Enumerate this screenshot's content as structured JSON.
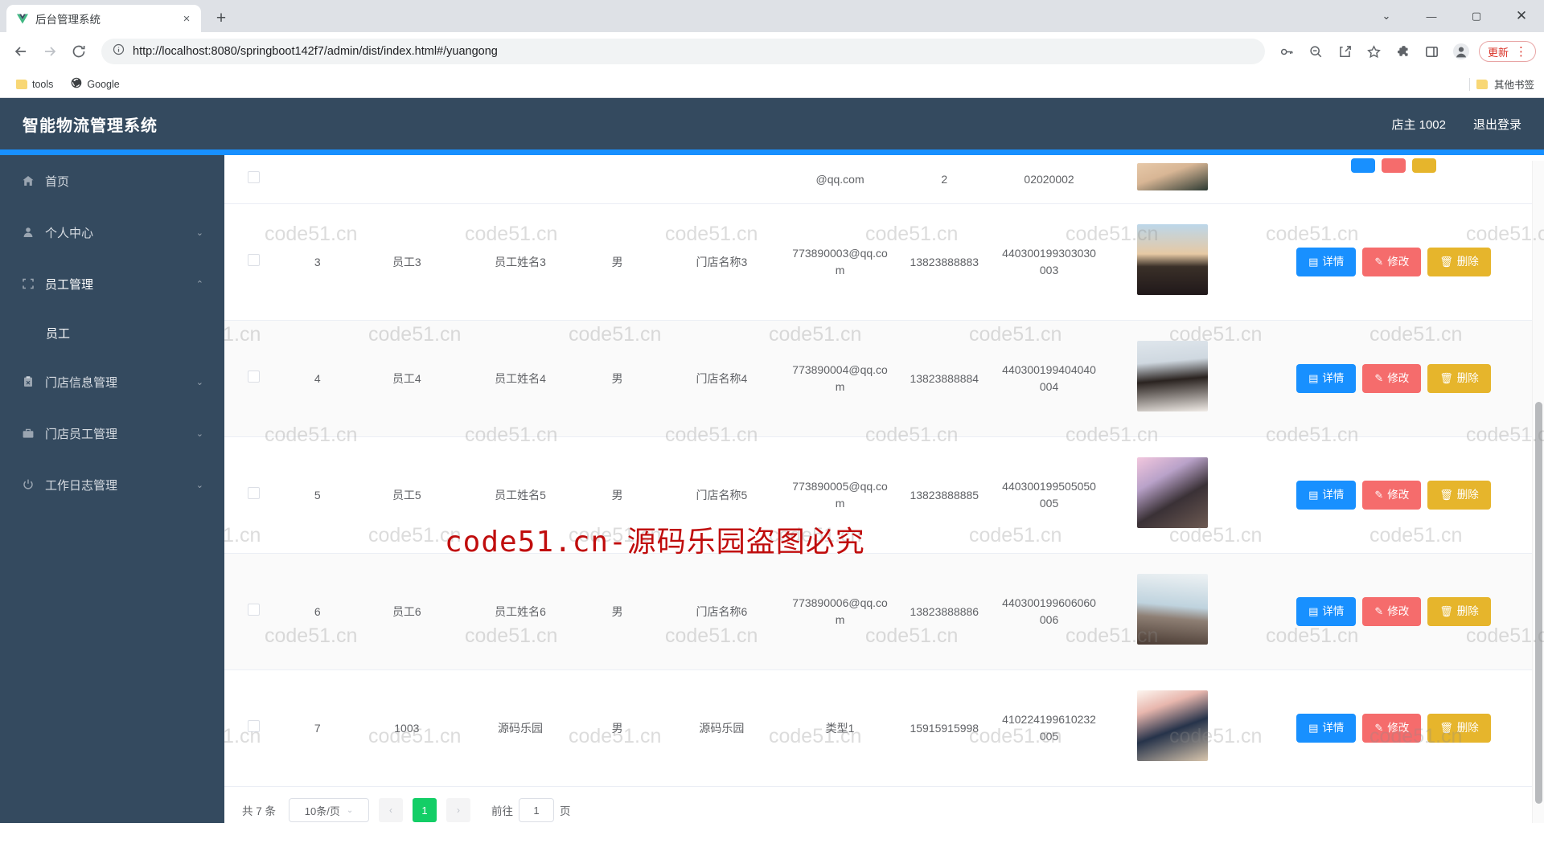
{
  "browser": {
    "tab": {
      "title": "后台管理系统",
      "favicon": "vue-logo-icon",
      "close": "×"
    },
    "new_tab": "+",
    "window_controls": {
      "minimize": "—",
      "maximize": "▢",
      "close": "✕",
      "chevron": "⌄"
    },
    "nav": {
      "back": "←",
      "forward": "→",
      "reload": "⟳"
    },
    "omnibox": {
      "info_icon": "ⓘ",
      "url": "http://localhost:8080/springboot142f7/admin/dist/index.html#/yuangong"
    },
    "toolbar_icons": [
      "key-icon",
      "zoom-out-icon",
      "share-icon",
      "star-icon",
      "extensions-icon",
      "side-panel-icon",
      "profile-icon"
    ],
    "update_pill": {
      "label": "更新",
      "menu": "⋮",
      "color": "#d93025"
    },
    "bookmarks": [
      {
        "label": "tools",
        "icon": "folder-icon"
      },
      {
        "label": "Google",
        "icon": "globe-icon"
      }
    ],
    "bookmarks_right": "其他书签"
  },
  "app": {
    "title": "智能物流管理系统",
    "user": "店主 1002",
    "logout": "退出登录",
    "accent": "#1890ff",
    "header_bg": "#344a5f"
  },
  "sidebar": {
    "items": [
      {
        "label": "首页",
        "icon": "home-icon",
        "arrow": "",
        "active": false
      },
      {
        "label": "个人中心",
        "icon": "user-icon",
        "arrow": "⌄",
        "active": false
      },
      {
        "label": "员工管理",
        "icon": "frame-icon",
        "arrow": "⌃",
        "active": true
      },
      {
        "label": "门店信息管理",
        "icon": "clipboard-icon",
        "arrow": "⌄",
        "active": false
      },
      {
        "label": "门店员工管理",
        "icon": "briefcase-icon",
        "arrow": "⌄",
        "active": false
      },
      {
        "label": "工作日志管理",
        "icon": "power-icon",
        "arrow": "⌄",
        "active": false
      }
    ],
    "sub_item": {
      "label": "员工",
      "parent": "员工管理"
    }
  },
  "table": {
    "rows": [
      {
        "id": "",
        "gonghao": "",
        "xingming": "",
        "xingbie": "",
        "mendian": "",
        "email": "@qq.com",
        "phone": "2",
        "idcard": "02020002",
        "avatar": "avatar-photo",
        "partial": true
      },
      {
        "id": "3",
        "gonghao": "员工3",
        "xingming": "员工姓名3",
        "xingbie": "男",
        "mendian": "门店名称3",
        "email": "773890003@qq.com",
        "phone": "13823888883",
        "idcard": "440300199303030003",
        "avatar": "avatar-photo",
        "partial": false
      },
      {
        "id": "4",
        "gonghao": "员工4",
        "xingming": "员工姓名4",
        "xingbie": "男",
        "mendian": "门店名称4",
        "email": "773890004@qq.com",
        "phone": "13823888884",
        "idcard": "440300199404040004",
        "avatar": "avatar-photo",
        "partial": false
      },
      {
        "id": "5",
        "gonghao": "员工5",
        "xingming": "员工姓名5",
        "xingbie": "男",
        "mendian": "门店名称5",
        "email": "773890005@qq.com",
        "phone": "13823888885",
        "idcard": "440300199505050005",
        "avatar": "avatar-photo",
        "partial": false
      },
      {
        "id": "6",
        "gonghao": "员工6",
        "xingming": "员工姓名6",
        "xingbie": "男",
        "mendian": "门店名称6",
        "email": "773890006@qq.com",
        "phone": "13823888886",
        "idcard": "440300199606060006",
        "avatar": "avatar-photo",
        "partial": false
      },
      {
        "id": "7",
        "gonghao": "1003",
        "xingming": "源码乐园",
        "xingbie": "男",
        "mendian": "源码乐园",
        "email": "类型1",
        "phone": "15915915998",
        "idcard": "410224199610232005",
        "avatar": "avatar-photo",
        "partial": false
      }
    ],
    "actions": {
      "detail": {
        "label": "详情",
        "icon": "document-icon",
        "color": "#1890ff"
      },
      "edit": {
        "label": "修改",
        "icon": "pencil-icon",
        "color": "#f56c6c"
      },
      "delete": {
        "label": "删除",
        "icon": "trash-icon",
        "color": "#e6b52c"
      }
    }
  },
  "pagination": {
    "total_label": "共 7 条",
    "page_size": "10条/页",
    "page_size_chevron": "⌄",
    "prev": "‹",
    "next": "›",
    "current_page": "1",
    "jump_prefix": "前往",
    "jump_value": "1",
    "jump_suffix": "页",
    "active_color": "#13ce66"
  },
  "watermark": {
    "tile_text": "code51.cn",
    "red_text": "code51.cn-源码乐园盗图必究",
    "red_color": "#c00d0d"
  }
}
